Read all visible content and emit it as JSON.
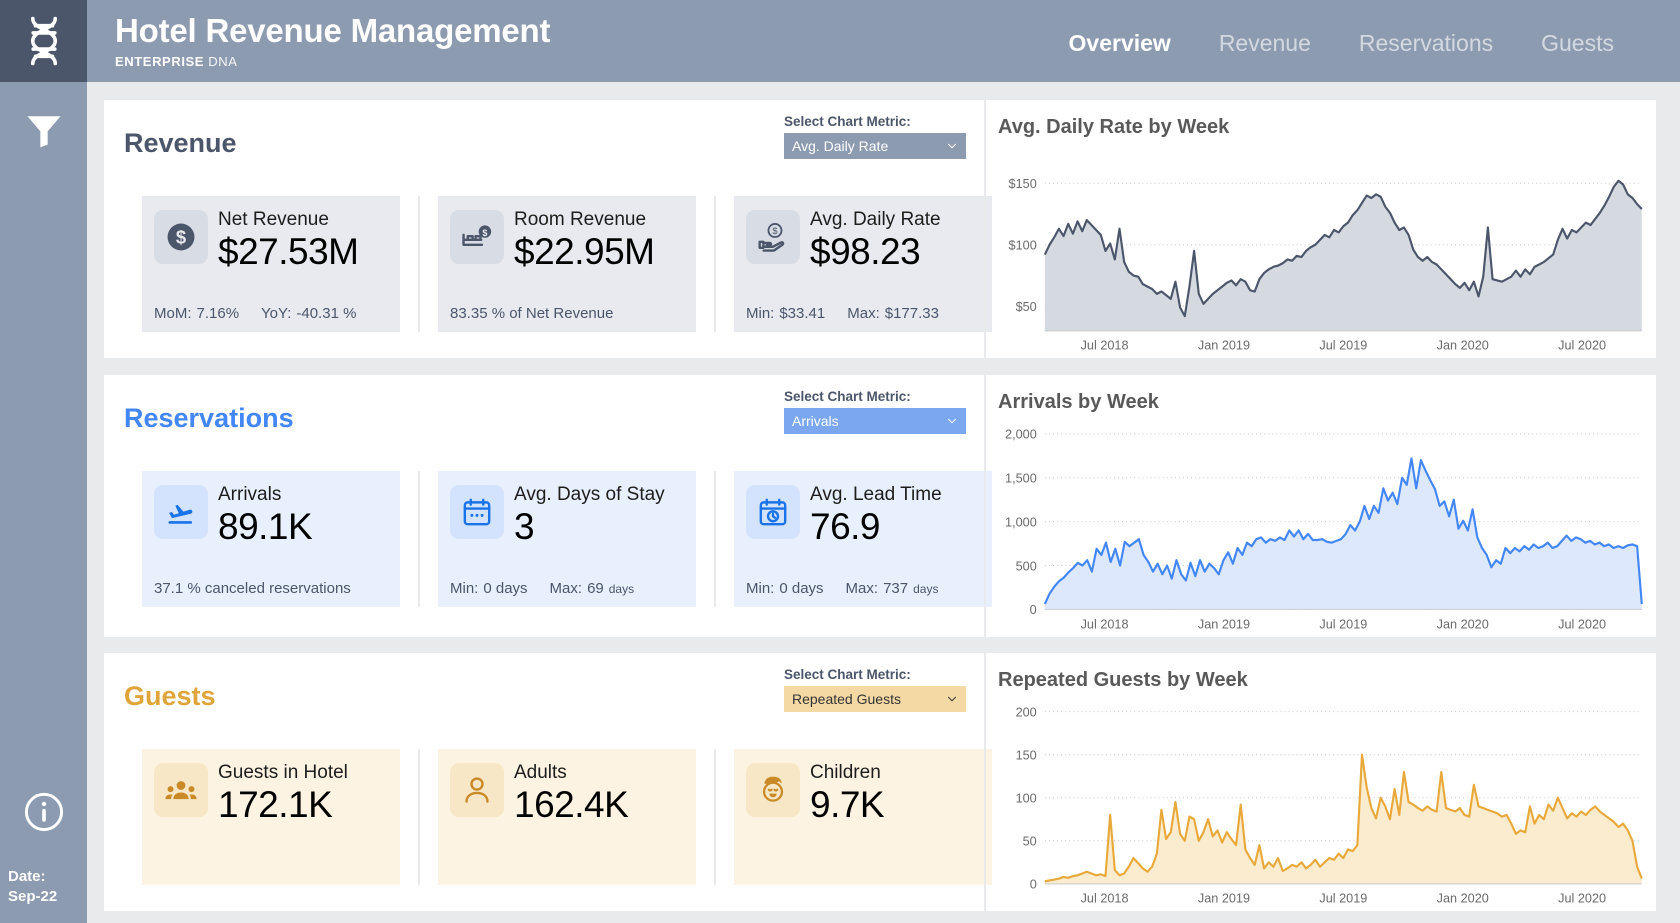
{
  "header": {
    "title": "Hotel Revenue Management",
    "brand_bold": "ENTERPRISE",
    "brand_light": " DNA",
    "logo_icon": "dna-helix-icon",
    "tabs": [
      {
        "label": "Overview",
        "active": true
      },
      {
        "label": "Revenue",
        "active": false
      },
      {
        "label": "Reservations",
        "active": false
      },
      {
        "label": "Guests",
        "active": false
      }
    ]
  },
  "sidebar": {
    "filter_icon": "funnel-filter-icon",
    "info_icon": "info-circle-icon",
    "date_label": "Date:",
    "date_value": "Sep-22"
  },
  "metric_label": "Select Chart Metric:",
  "sections": [
    {
      "title": "Revenue",
      "accent": "#4c566b",
      "selected_metric": "Avg. Daily Rate",
      "cards": [
        {
          "icon": "dollar-circle-icon",
          "name": "Net Revenue",
          "value": "$27.53M",
          "foot": [
            {
              "label": "MoM:",
              "value": "7.16%"
            },
            {
              "label": "YoY:",
              "value": "-40.31 %"
            }
          ]
        },
        {
          "icon": "bed-dollar-icon",
          "name": "Room Revenue",
          "value": "$22.95M",
          "foot": [
            {
              "label": "83.35 % of Net Revenue",
              "value": ""
            }
          ]
        },
        {
          "icon": "hand-dollar-icon",
          "name": "Avg. Daily Rate",
          "value": "$98.23",
          "foot": [
            {
              "label": "Min:",
              "value": "$33.41"
            },
            {
              "label": "Max:",
              "value": "$177.33"
            }
          ]
        }
      ]
    },
    {
      "title": "Reservations",
      "accent": "#4287f5",
      "selected_metric": "Arrivals",
      "cards": [
        {
          "icon": "airplane-landing-icon",
          "name": "Arrivals",
          "value": "89.1K",
          "foot": [
            {
              "label": "37.1 %  canceled reservations",
              "value": ""
            }
          ]
        },
        {
          "icon": "calendar-icon",
          "name": "Avg. Days of Stay",
          "value": "3",
          "foot": [
            {
              "label": "Min:",
              "value": "0 days"
            },
            {
              "label": "Max:",
              "value": "69",
              "unit": "days"
            }
          ]
        },
        {
          "icon": "calendar-clock-icon",
          "name": "Avg. Lead Time",
          "value": "76.9",
          "foot": [
            {
              "label": "Min:",
              "value": "0 days"
            },
            {
              "label": "Max:",
              "value": "737",
              "unit": "days"
            }
          ]
        }
      ]
    },
    {
      "title": "Guests",
      "accent": "#e0a53a",
      "selected_metric": "Repeated Guests",
      "cards": [
        {
          "icon": "people-group-icon",
          "name": "Guests in Hotel",
          "value": "172.1K",
          "foot": []
        },
        {
          "icon": "person-icon",
          "name": "Adults",
          "value": "162.4K",
          "foot": []
        },
        {
          "icon": "child-face-icon",
          "name": "Children",
          "value": "9.7K",
          "foot": []
        }
      ]
    }
  ],
  "chart_data": [
    {
      "type": "area",
      "title": "Avg. Daily Rate by Week",
      "xlabel": "",
      "ylabel": "",
      "line_color": "#4c566b",
      "fill_color": "#d5d9e0",
      "ylim": [
        30,
        170
      ],
      "yticks": [
        50,
        100,
        150
      ],
      "ytick_labels": [
        "$50",
        "$100",
        "$150"
      ],
      "xtick_labels": [
        "Jul 2018",
        "Jan 2019",
        "Jul 2019",
        "Jan 2020",
        "Jul 2020"
      ],
      "grid": true,
      "values": [
        92,
        100,
        106,
        113,
        107,
        117,
        109,
        119,
        111,
        120,
        116,
        112,
        108,
        95,
        101,
        88,
        113,
        86,
        78,
        75,
        74,
        68,
        66,
        64,
        60,
        62,
        59,
        56,
        70,
        49,
        42,
        66,
        95,
        60,
        52,
        56,
        60,
        63,
        66,
        69,
        71,
        67,
        72,
        70,
        63,
        62,
        72,
        77,
        80,
        82,
        83,
        85,
        88,
        87,
        91,
        90,
        95,
        98,
        100,
        104,
        108,
        106,
        112,
        110,
        115,
        118,
        124,
        128,
        134,
        140,
        138,
        141,
        139,
        131,
        126,
        118,
        112,
        114,
        108,
        96,
        90,
        87,
        90,
        86,
        84,
        80,
        76,
        72,
        68,
        65,
        69,
        63,
        70,
        58,
        74,
        114,
        72,
        71,
        70,
        72,
        74,
        79,
        74,
        80,
        76,
        82,
        84,
        86,
        89,
        92,
        104,
        113,
        105,
        112,
        110,
        114,
        118,
        116,
        121,
        126,
        132,
        139,
        147,
        152,
        149,
        141,
        138,
        133,
        129
      ]
    },
    {
      "type": "area",
      "title": "Arrivals by Week",
      "xlabel": "",
      "ylabel": "",
      "line_color": "#4287f5",
      "fill_color": "#dde8fc",
      "ylim": [
        0,
        2000
      ],
      "yticks": [
        0,
        500,
        1000,
        1500,
        2000
      ],
      "ytick_labels": [
        "0",
        "500",
        "1,000",
        "1,500",
        "2,000"
      ],
      "xtick_labels": [
        "Jul 2018",
        "Jan 2019",
        "Jul 2019",
        "Jan 2020",
        "Jul 2020"
      ],
      "grid": true,
      "values": [
        60,
        180,
        260,
        320,
        360,
        420,
        470,
        530,
        500,
        560,
        430,
        690,
        620,
        760,
        540,
        690,
        500,
        770,
        720,
        760,
        800,
        620,
        540,
        430,
        520,
        400,
        500,
        350,
        560,
        400,
        330,
        530,
        380,
        560,
        430,
        520,
        470,
        400,
        560,
        650,
        520,
        700,
        620,
        760,
        720,
        800,
        820,
        760,
        800,
        780,
        820,
        790,
        900,
        830,
        900,
        800,
        860,
        790,
        790,
        800,
        770,
        760,
        780,
        800,
        860,
        960,
        900,
        1000,
        1180,
        1030,
        1180,
        1100,
        1380,
        1240,
        1330,
        1200,
        1500,
        1420,
        1720,
        1380,
        1700,
        1580,
        1470,
        1370,
        1180,
        1230,
        1060,
        1250,
        920,
        1010,
        900,
        1140,
        820,
        700,
        620,
        480,
        560,
        520,
        700,
        640,
        700,
        660,
        720,
        680,
        740,
        700,
        720,
        760,
        700,
        720,
        780,
        840,
        780,
        820,
        800,
        760,
        780,
        740,
        760,
        720,
        740,
        700,
        720,
        700,
        730,
        740,
        720,
        60
      ]
    },
    {
      "type": "area",
      "title": "Repeated Guests by Week",
      "xlabel": "",
      "ylabel": "",
      "line_color": "#e8a93a",
      "fill_color": "#fbeccf",
      "ylim": [
        0,
        200
      ],
      "yticks": [
        0,
        50,
        100,
        150,
        200
      ],
      "ytick_labels": [
        "0",
        "50",
        "100",
        "150",
        "200"
      ],
      "xtick_labels": [
        "Jul 2018",
        "Jan 2019",
        "Jul 2019",
        "Jan 2020",
        "Jul 2020"
      ],
      "grid": true,
      "values": [
        3,
        4,
        5,
        6,
        8,
        7,
        9,
        10,
        12,
        14,
        12,
        10,
        11,
        9,
        80,
        16,
        10,
        12,
        20,
        30,
        24,
        18,
        14,
        20,
        35,
        86,
        52,
        60,
        95,
        58,
        50,
        78,
        75,
        50,
        60,
        75,
        55,
        62,
        48,
        60,
        52,
        45,
        92,
        40,
        30,
        22,
        45,
        18,
        25,
        20,
        30,
        15,
        18,
        22,
        20,
        25,
        18,
        22,
        28,
        20,
        25,
        30,
        28,
        35,
        30,
        40,
        38,
        45,
        150,
        112,
        88,
        76,
        100,
        90,
        75,
        110,
        80,
        130,
        95,
        92,
        88,
        85,
        90,
        86,
        84,
        130,
        88,
        86,
        84,
        88,
        80,
        78,
        115,
        90,
        88,
        86,
        84,
        82,
        78,
        80,
        70,
        58,
        62,
        60,
        90,
        70,
        80,
        75,
        92,
        85,
        100,
        88,
        76,
        82,
        78,
        84,
        80,
        86,
        90,
        84,
        80,
        76,
        72,
        66,
        70,
        62,
        50,
        20,
        6
      ]
    }
  ]
}
